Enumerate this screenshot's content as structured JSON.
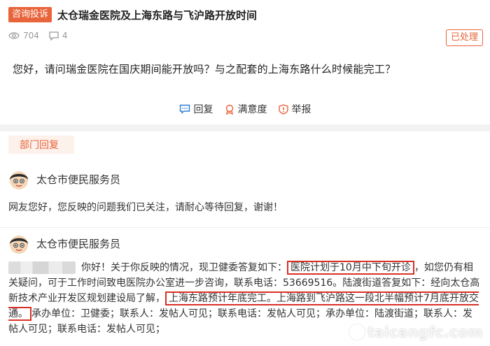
{
  "post": {
    "tag": "咨询投诉",
    "title": "太仓瑞金医院及上海东路与飞沪路开放时间",
    "views": "704",
    "comments": "4",
    "status": "已处理",
    "question": "您好，请问瑞金医院在国庆期间能开放吗？与之配套的上海东路什么时候能完工？"
  },
  "actions": {
    "reply": "回复",
    "satisfaction": "满意度",
    "report": "举报"
  },
  "section_tab": "部门回复",
  "replies": [
    {
      "name": "太仓市便民服务员",
      "text": "网友您好，您反映的问题我们已关注，请耐心等待回复，谢谢！"
    },
    {
      "name": "太仓市便民服务员",
      "intro": "你好！关于你反映的情况，现卫健委答复如下：",
      "hl1": "医院计划于10月中下旬开诊",
      "mid1": "，如您仍有相关疑问，可于工作时间致电医院办公室进一步咨询，联系电话：53669516。陆渡街道答复如下：经向太仓高新技术产业开发区规划建设局了解，",
      "hl2": "上海东路预计年底完工。上海路到飞沪路这一段北半幅预计7月底开放交通。",
      "tail": "承办单位：卫健委；联系人：发帖人可见；联系电话：发帖人可见；承办单位：陆渡街道；联系人：发帖人可见；联系电话：发帖人可见；"
    }
  ],
  "watermark": "taicangfc.com",
  "colors": {
    "accent": "#e8643a",
    "highlight_box": "#d93025",
    "reply_icon": "#2f7fd6"
  }
}
